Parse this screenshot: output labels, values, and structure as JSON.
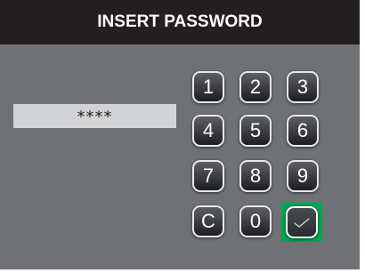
{
  "header": {
    "title": "INSERT PASSWORD"
  },
  "password": {
    "value": "****"
  },
  "keypad": {
    "keys": [
      "1",
      "2",
      "3",
      "4",
      "5",
      "6",
      "7",
      "8",
      "9",
      "C",
      "0"
    ],
    "confirm_icon": "checkmark-icon"
  },
  "colors": {
    "header_bg": "#231f20",
    "panel_bg": "#6f7175",
    "field_bg": "#d2d3d5",
    "confirm_highlight": "#00a651"
  }
}
